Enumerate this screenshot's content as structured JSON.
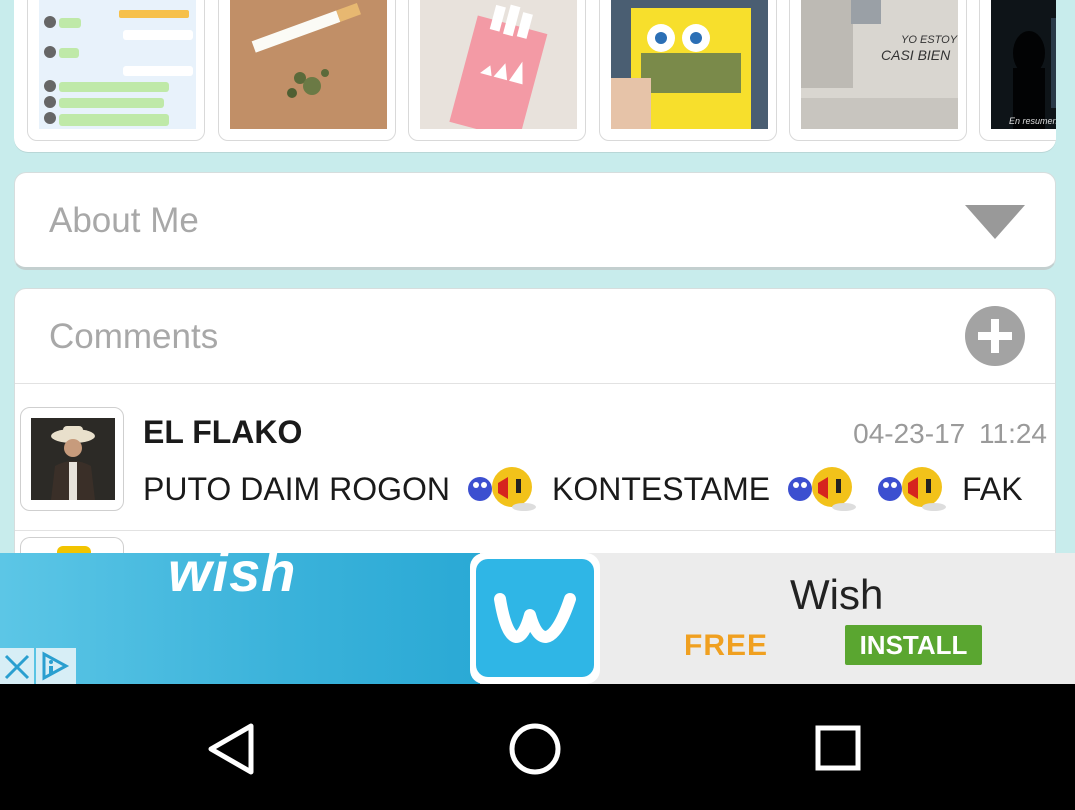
{
  "photos": [
    {
      "name": "chat-screenshot-photo",
      "caption": ""
    },
    {
      "name": "cigarette-photo",
      "caption": ""
    },
    {
      "name": "adidas-box-photo",
      "caption": "adidas"
    },
    {
      "name": "spongebob-box-photo",
      "caption": ""
    },
    {
      "name": "wall-graffiti-photo",
      "caption": "YO ESTOY CASI BIEN"
    },
    {
      "name": "dark-figure-photo",
      "caption": "En resumen"
    }
  ],
  "about": {
    "title": "About Me"
  },
  "comments": {
    "title": "Comments",
    "items": [
      {
        "author": "EL FLAKO",
        "time": "04-23-17  11:24",
        "text_parts": [
          "PUTO DAIM ROGON",
          "KONTESTAME",
          "FAK"
        ]
      }
    ]
  },
  "ad": {
    "brand_word": "wish",
    "title": "Wish",
    "price": "FREE",
    "install_label": "INSTALL"
  },
  "colors": {
    "page_bg": "#c8ecec",
    "install": "#5aa630",
    "free": "#f0a020",
    "wish_blue": "#2fb6e6"
  }
}
